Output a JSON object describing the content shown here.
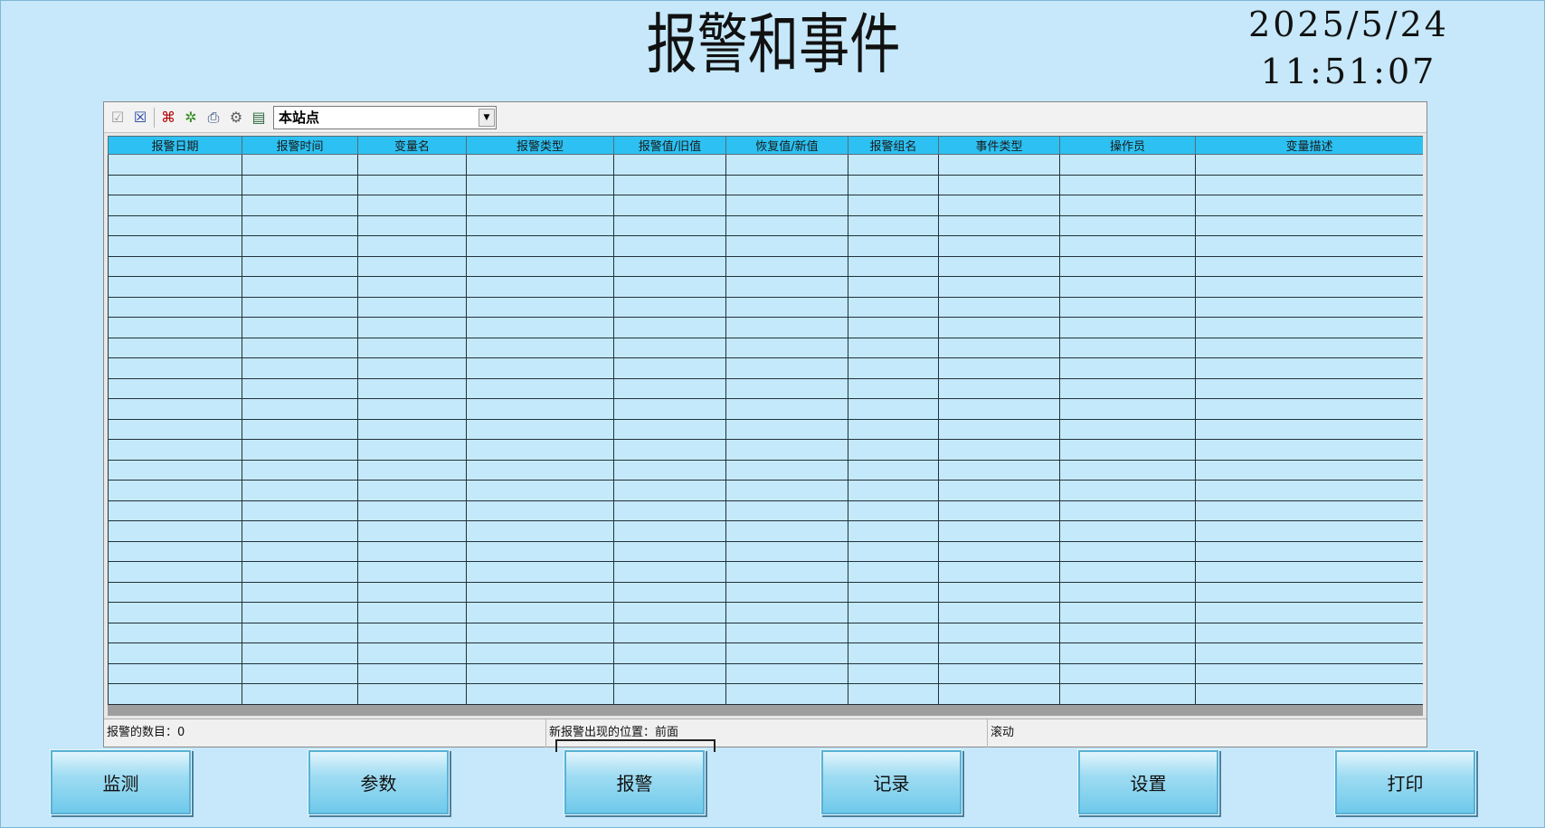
{
  "header": {
    "title": "报警和事件",
    "date": "2025/5/24",
    "time": "11:51:07"
  },
  "toolbar": {
    "icons": [
      "check-icon",
      "cross-box-icon",
      "filter-icon",
      "refresh-icon",
      "print-icon",
      "config-icon",
      "export-icon"
    ],
    "station_selected": "本站点"
  },
  "table": {
    "columns": [
      "报警日期",
      "报警时间",
      "变量名",
      "报警类型",
      "报警值/旧值",
      "恢复值/新值",
      "报警组名",
      "事件类型",
      "操作员",
      "变量描述"
    ],
    "rows": []
  },
  "status": {
    "alarm_count": "报警的数目：0",
    "new_alarm_position": "新报警出现的位置：前面",
    "scroll": "滚动"
  },
  "nav": {
    "monitor": "监测",
    "params": "参数",
    "alarm": "报警",
    "record": "记录",
    "settings": "设置",
    "print": "打印"
  },
  "colors": {
    "background": "#c6e8fa",
    "header_row": "#2cc1f2",
    "cell": "#c4e9fa"
  }
}
